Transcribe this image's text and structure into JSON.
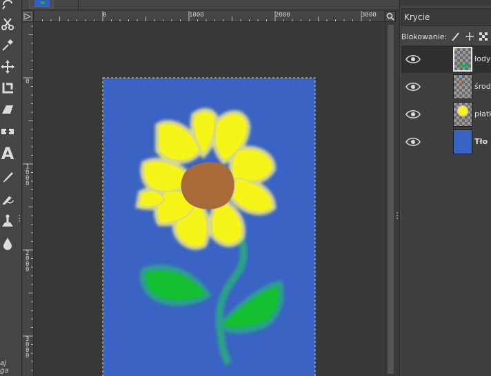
{
  "tools": [
    {
      "name": "fuzzy-lasso-tool-icon"
    },
    {
      "name": "scissors-select-tool-icon"
    },
    {
      "name": "color-picker-tool-icon"
    },
    {
      "name": "move-tool-icon"
    },
    {
      "name": "crop-tool-icon"
    },
    {
      "name": "perspective-tool-icon"
    },
    {
      "name": "flip-tool-icon"
    },
    {
      "name": "text-tool-icon"
    },
    {
      "name": "paintbrush-tool-icon"
    },
    {
      "name": "ink-tool-icon"
    },
    {
      "name": "clone-tool-icon"
    },
    {
      "name": "smudge-tool-icon"
    }
  ],
  "toolbox": {
    "text_tool_glyph": "A",
    "hint_line1": "aj",
    "hint_line2": "ga"
  },
  "ruler": {
    "h_labels": [
      "0",
      "1000",
      "2000",
      "3000"
    ],
    "v_labels": [
      "0",
      "1000",
      "2000",
      "3000"
    ]
  },
  "layers_panel": {
    "mode_label": "Krycie",
    "lock_label": "Blokowanie:",
    "layers": [
      {
        "name": "łodyga",
        "label_shown": "łodyg",
        "visible": true,
        "active": true
      },
      {
        "name": "środek",
        "label_shown": "środe",
        "visible": true,
        "active": false
      },
      {
        "name": "płatki",
        "label_shown": "płatk",
        "visible": true,
        "active": false
      },
      {
        "name": "Tło",
        "label_shown": "Tło",
        "visible": true,
        "active": false
      }
    ]
  },
  "colors": {
    "canvas_background": "#3a63c4",
    "petal": "#f6f51a",
    "petal_glow": "#d9d98a",
    "flower_center": "#a86a38",
    "leaf": "#12c030",
    "stem_glow": "#2aa08a",
    "panel": "#454545"
  }
}
